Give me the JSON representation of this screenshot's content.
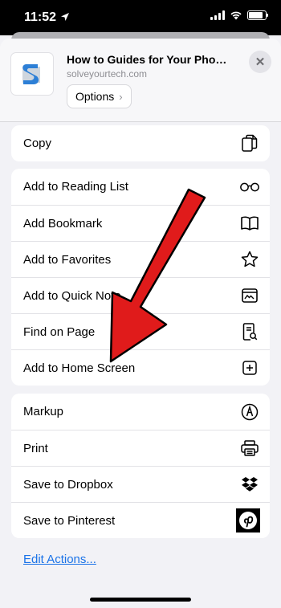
{
  "status": {
    "time": "11:52"
  },
  "header": {
    "title": "How to Guides for Your Phon...",
    "url": "solveyourtech.com",
    "options_label": "Options"
  },
  "groups": [
    {
      "items": [
        {
          "label": "Copy",
          "icon": "copy-icon"
        }
      ]
    },
    {
      "items": [
        {
          "label": "Add to Reading List",
          "icon": "glasses-icon"
        },
        {
          "label": "Add Bookmark",
          "icon": "book-icon"
        },
        {
          "label": "Add to Favorites",
          "icon": "star-icon"
        },
        {
          "label": "Add to Quick Note",
          "icon": "quick-note-icon"
        },
        {
          "label": "Find on Page",
          "icon": "find-on-page-icon"
        },
        {
          "label": "Add to Home Screen",
          "icon": "plus-square-icon"
        }
      ]
    },
    {
      "items": [
        {
          "label": "Markup",
          "icon": "markup-icon"
        },
        {
          "label": "Print",
          "icon": "printer-icon"
        },
        {
          "label": "Save to Dropbox",
          "icon": "dropbox-icon"
        },
        {
          "label": "Save to Pinterest",
          "icon": "pinterest-icon"
        }
      ]
    }
  ],
  "edit_actions_label": "Edit Actions...",
  "colors": {
    "link": "#1a73e8",
    "arrow_red": "#e01b1b"
  }
}
